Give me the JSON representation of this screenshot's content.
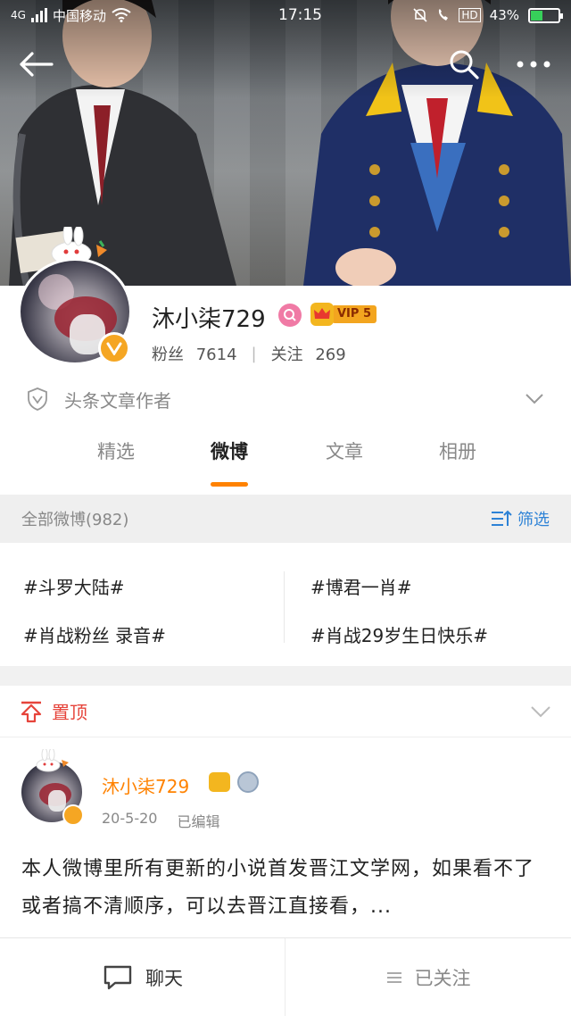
{
  "status_bar": {
    "network": "4G",
    "carrier": "中国移动",
    "time": "17:15",
    "hd": "HD",
    "battery": "43%",
    "battery_level": 0.43
  },
  "profile": {
    "nickname": "沐小柒729",
    "vip": "VIP 5",
    "followers_label": "粉丝",
    "followers": "7614",
    "following_label": "关注",
    "following": "269",
    "authorship": "头条文章作者"
  },
  "tabs": [
    "精选",
    "微博",
    "文章",
    "相册"
  ],
  "active_tab": "微博",
  "filter_bar": {
    "title": "全部微博(982)",
    "filter_label": "筛选"
  },
  "topics": [
    "#斗罗大陆#",
    "#博君一肖#",
    "#肖战粉丝 录音#",
    "#肖战29岁生日快乐#"
  ],
  "pinned": {
    "label": "置顶"
  },
  "post": {
    "author": "沐小柒729",
    "date": "20-5-20",
    "edited": "已编辑",
    "text": "本人微博里所有更新的小说首发晋江文学网，如果看不了或者搞不清顺序，可以去晋江直接看，..."
  },
  "bottom_bar": {
    "chat": "聊天",
    "followed": "已关注"
  },
  "colors": {
    "accent": "#ff8200",
    "filter_blue": "#2d82d6",
    "pinned_red": "#e6443b",
    "verified": "#f5a623"
  }
}
